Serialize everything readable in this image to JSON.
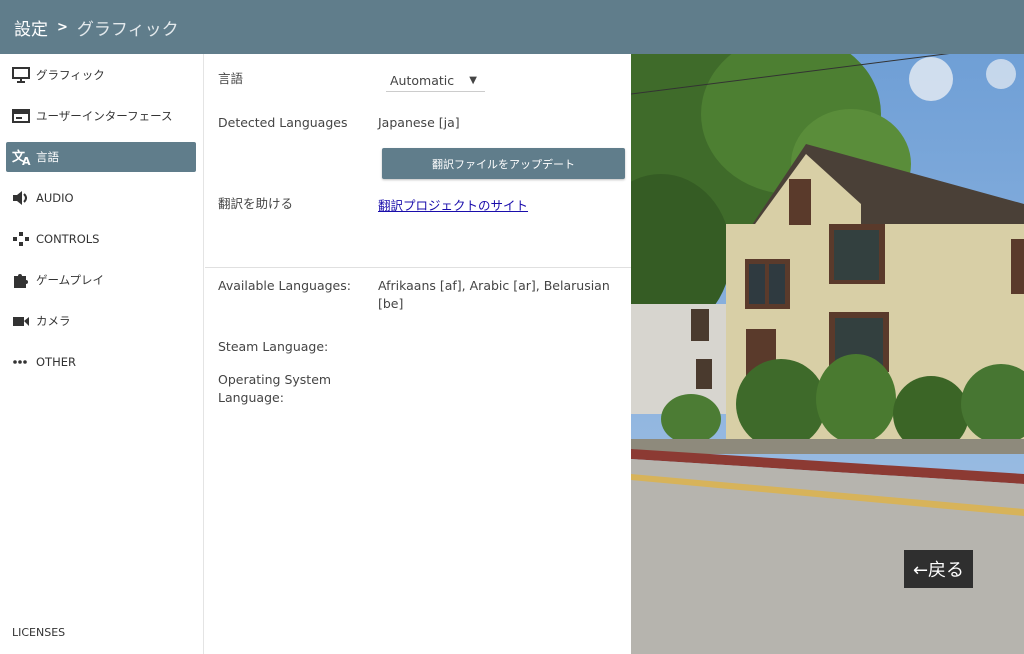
{
  "header": {
    "breadcrumb_root": "設定",
    "separator": ">",
    "breadcrumb_current": "グラフィック"
  },
  "sidebar": {
    "items": [
      {
        "label": "グラフィック",
        "icon": "monitor-icon"
      },
      {
        "label": "ユーザーインターフェース",
        "icon": "window-icon"
      },
      {
        "label": "言語",
        "icon": "translate-icon",
        "active": true
      },
      {
        "label": "AUDIO",
        "icon": "speaker-icon"
      },
      {
        "label": "CONTROLS",
        "icon": "gamepad-icon"
      },
      {
        "label": "ゲームプレイ",
        "icon": "puzzle-icon"
      },
      {
        "label": "カメラ",
        "icon": "video-camera-icon"
      },
      {
        "label": "OTHER",
        "icon": "more-icon"
      }
    ],
    "licenses": "LICENSES"
  },
  "language": {
    "language_label": "言語",
    "language_value": "Automatic",
    "detected_label": "Detected Languages",
    "detected_value": "Japanese [ja]",
    "update_button": "翻訳ファイルをアップデート",
    "help_label": "翻訳を助ける",
    "help_link": "翻訳プロジェクトのサイト",
    "available_label": "Available Languages:",
    "available_value": "Afrikaans [af], Arabic [ar], Belarusian [be]",
    "steam_label": "Steam Language:",
    "os_label": "Operating System Language:"
  },
  "back_button": "←戻る",
  "colors": {
    "accent": "#607d8b",
    "link": "#1a0dab"
  }
}
